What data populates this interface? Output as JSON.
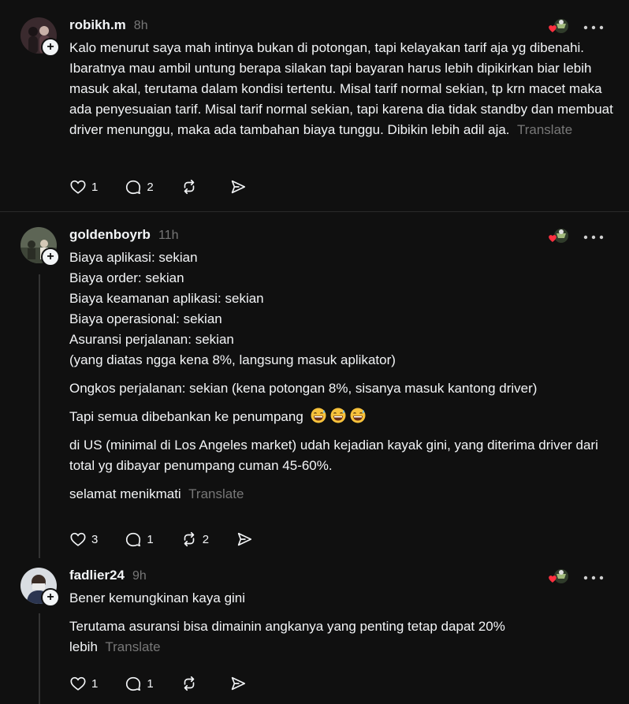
{
  "posts": [
    {
      "username": "robikh.m",
      "time": "8h",
      "paragraphs": [
        "Kalo menurut saya mah intinya bukan di potongan, tapi kelayakan tarif aja yg dibenahi. Ibaratnya mau ambil untung berapa silakan tapi bayaran harus lebih dipikirkan biar lebih masuk akal, terutama dalam kondisi tertentu. Misal tarif normal sekian, tp krn macet maka ada penyesuaian tarif. Misal tarif normal sekian, tapi karena dia tidak standby dan membuat driver menunggu, maka ada tambahan biaya tunggu. Dibikin lebih adil aja."
      ],
      "translate": "Translate",
      "likes": "1",
      "replies": "2",
      "reposts": ""
    },
    {
      "username": "goldenboyrb",
      "time": "11h",
      "paragraphs": [
        "Biaya aplikasi: sekian\nBiaya order: sekian\nBiaya keamanan aplikasi: sekian\nBiaya operasional: sekian\nAsuransi perjalanan: sekian\n(yang diatas ngga kena 8%, langsung masuk aplikator)",
        "Ongkos perjalanan: sekian (kena potongan 8%, sisanya masuk kantong driver)",
        "Tapi semua dibebankan ke penumpang",
        "di US (minimal di Los Angeles market) udah kejadian kayak gini, yang diterima driver dari total yg dibayar penumpang cuman 45-60%.",
        "selamat menikmati"
      ],
      "emojis": [
        "grinning-sweat-emoji",
        "grinning-sweat-emoji",
        "grinning-sweat-emoji"
      ],
      "translate": "Translate",
      "likes": "3",
      "replies": "1",
      "reposts": "2"
    },
    {
      "username": "fadlier24",
      "time": "9h",
      "paragraphs": [
        "Bener kemungkinan kaya gini",
        "Terutama asuransi bisa dimainin angkanya yang penting tetap dapat 20% lebih"
      ],
      "translate": "Translate",
      "likes": "1",
      "replies": "1",
      "reposts": ""
    }
  ],
  "icons": {
    "like": "heart-icon",
    "reply": "comment-icon",
    "repost": "repost-icon",
    "share": "send-icon",
    "more": "more-icon",
    "follow": "plus-icon"
  },
  "colors": {
    "background": "#101010",
    "text": "#f3f5f7",
    "muted": "#777777",
    "heart": "#ff3040"
  }
}
